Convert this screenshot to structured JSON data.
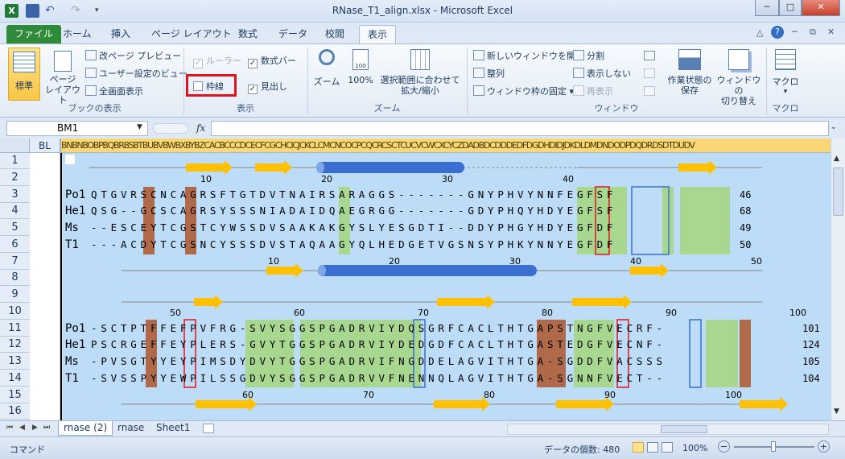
{
  "window": {
    "title": "RNase_T1_align.xlsx - Microsoft Excel",
    "minimize": "─",
    "maximize": "□",
    "close": "✕"
  },
  "tabs": [
    "ファイル",
    "ホーム",
    "挿入",
    "ページ レイアウト",
    "数式",
    "データ",
    "校閲",
    "表示"
  ],
  "active_tab": "表示",
  "ribbon": {
    "book_views": {
      "label": "ブックの表示",
      "normal": "標準",
      "page_layout": "ページ\nレイアウト",
      "page_break": "改ページ プレビュー",
      "custom_views": "ユーザー設定のビュー",
      "full_screen": "全画面表示"
    },
    "show": {
      "label": "表示",
      "ruler": "ルーラー",
      "formula_bar": "数式バー",
      "gridlines": "枠線",
      "headings": "見出し"
    },
    "zoom": {
      "label": "ズーム",
      "zoom": "ズーム",
      "hundred": "100%",
      "zoom_selection": "選択範囲に合わせて\n拡大/縮小"
    },
    "window": {
      "label": "ウィンドウ",
      "new_window": "新しいウィンドウを開く",
      "arrange": "整列",
      "freeze": "ウィンドウ枠の固定",
      "split": "分割",
      "hide": "表示しない",
      "unhide": "再表示",
      "save_workspace": "作業状態の\n保存",
      "switch_windows": "ウィンドウの\n切り替え"
    },
    "macros": {
      "label": "マクロ",
      "macros": "マクロ"
    }
  },
  "formula_bar": {
    "name_box": "BM1",
    "fx": "fx",
    "value": ""
  },
  "grid": {
    "col_header_bl": "BL",
    "col_header_rest": "BNBNBOBPBQBRBSBTBUBVBWBXBYBZCACBCCCDCECFCGCHCICJCKCLCMCNCOCPCQCRCSCTCUCVCWCXCYCZDADBDCDDDEDFDGDHDIDJDKDLDMDNDODPDQDRDSDTDUDV",
    "rows": [
      "1",
      "2",
      "3",
      "4",
      "5",
      "6",
      "7",
      "8",
      "9",
      "10",
      "11",
      "12",
      "13",
      "14",
      "15",
      "16"
    ],
    "numbers_top": [
      "10",
      "20",
      "30",
      "40"
    ],
    "numbers_mid1": [
      "10",
      "20",
      "30",
      "40",
      "50"
    ],
    "numbers_mid2": [
      "50",
      "60",
      "70",
      "80",
      "90",
      "100"
    ],
    "numbers_bot": [
      "60",
      "70",
      "80",
      "90",
      "100"
    ],
    "block1": [
      {
        "name": "Po1",
        "seq": "QTGVRSCNCAGRSFTGTDVTNAIRSARAGGS-------GNYPHVYNNFEGFSF",
        "end": "46"
      },
      {
        "name": "He1",
        "seq": "QSG--GCSCAGRSYSSSNIADAIDQAEGRGG-------GDYPHQYHDYEGFSF",
        "end": "68"
      },
      {
        "name": "Ms",
        "seq": "--ESCEYTCGSTCYWSSDVSAAKAKGYSLYESGDTI--DDYPHGYHDYEGFDF",
        "end": "49"
      },
      {
        "name": "T1",
        "seq": "---ACDYTCGSNCYSSSDVSTAQAAGYQLHEDGETVGSNSYPHKYNNYEGFDF",
        "end": "50"
      }
    ],
    "block2": [
      {
        "name": "Po1",
        "seq": "-SCTPTFFEFPVFRG-SVYSGGSPGADRVIYDQSGRFCACLTHTGAPSTNGFVECRF-",
        "end": "101"
      },
      {
        "name": "He1",
        "seq": "PSCRGEFFEYPLERS-GVYTGGSPGADRVIYDEDGDFCACLTHTGASTEDGFVECNF-",
        "end": "124"
      },
      {
        "name": "Ms",
        "seq": "-PVSGTYYEYPIMSDYDVYTGGSPGADRVIFNGDDELAGVITHTGA-SGDDFVACSSS",
        "end": "105"
      },
      {
        "name": "T1",
        "seq": "-SVSSPYYEWPILSSGDVYSGGSPGADRVVFNENNQLAGVITHTGA-SGNNFVECT--",
        "end": "104"
      }
    ]
  },
  "sheet_tabs": [
    "rnase (2)",
    "rnase",
    "Sheet1"
  ],
  "active_sheet": "rnase (2)",
  "status": {
    "mode": "コマンド",
    "count": "データの個数: 480",
    "zoom": "100%",
    "minus": "−",
    "plus": "+"
  },
  "colors": {
    "accent_green": "#2f8a3a",
    "highlight_red": "#e0141e",
    "helix_blue": "#3b6ed1",
    "strand_orange": "#ffc000",
    "cys_brown": "#b06a4a",
    "cons_green": "#a8d890",
    "sheet_bg": "#bcdcf7"
  }
}
